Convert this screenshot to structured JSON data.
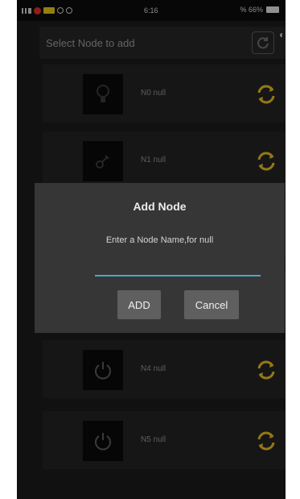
{
  "status_bar": {
    "time": "6:16",
    "right_text": "% 66%"
  },
  "header": {
    "title": "Select Node to add"
  },
  "nodes": [
    {
      "label": "N0 null",
      "thumb_icon": "bulb-icon"
    },
    {
      "label": "N1 null",
      "thumb_icon": "plug-icon"
    },
    {
      "label": "N4 null",
      "thumb_icon": "power-icon"
    },
    {
      "label": "N5 null",
      "thumb_icon": "power-icon"
    }
  ],
  "dialog": {
    "title": "Add Node",
    "message": "Enter a Node Name,for null",
    "input_value": "",
    "add_label": "ADD",
    "cancel_label": "Cancel"
  },
  "colors": {
    "accent_underline": "#4aa9c7",
    "refresh_icon": "#e3b821",
    "dialog_bg": "#363636"
  }
}
